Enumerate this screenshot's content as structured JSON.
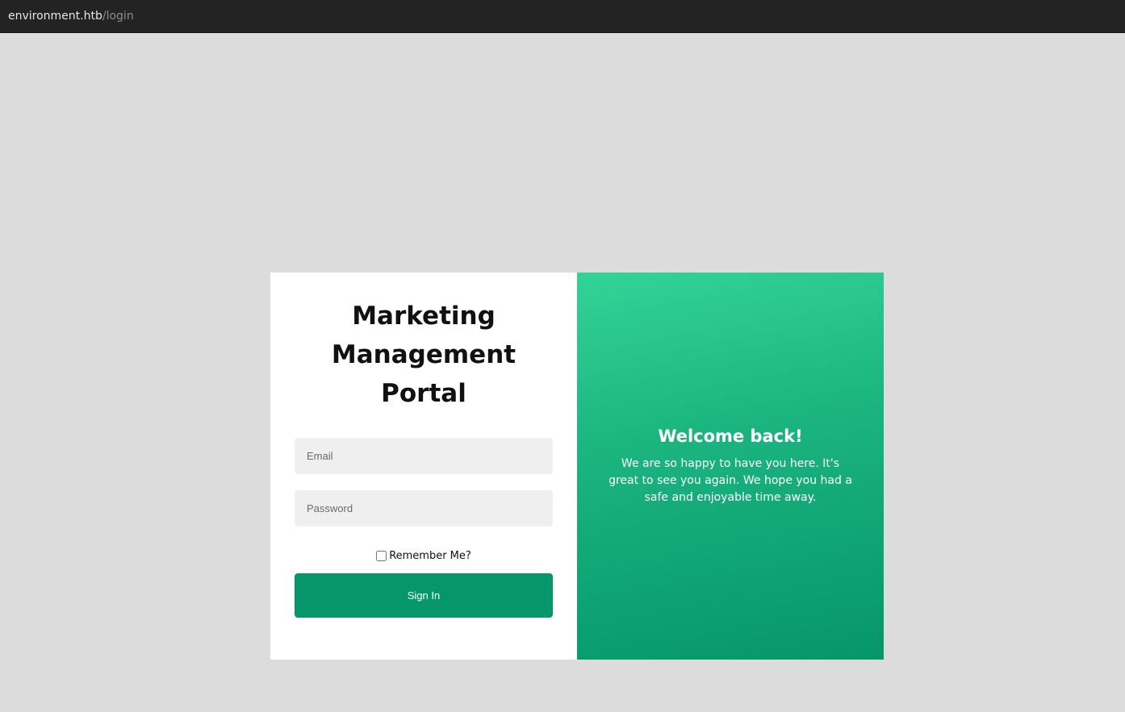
{
  "browser": {
    "url_host": "environment.htb",
    "url_path": "/login"
  },
  "login": {
    "title": "Marketing Management Portal",
    "email_placeholder": "Email",
    "password_placeholder": "Password",
    "remember_label": "Remember Me?",
    "signin_label": "Sign In"
  },
  "welcome": {
    "title": "Welcome back!",
    "text": "We are so happy to have you here. It's great to see you again. We hope you had a safe and enjoyable time away."
  },
  "colors": {
    "accent": "#059669",
    "gradient_start": "#33d398",
    "page_background": "#dcdcdc",
    "topbar_background": "#232323"
  }
}
